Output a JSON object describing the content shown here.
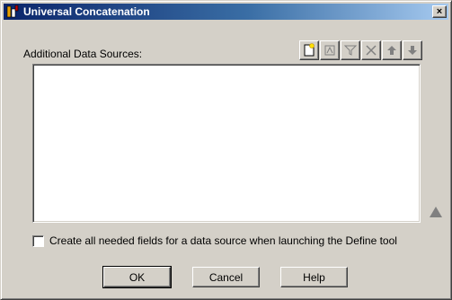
{
  "window": {
    "title": "Universal Concatenation",
    "close_glyph": "×"
  },
  "sources": {
    "label": "Additional Data Sources:",
    "items": []
  },
  "toolbar": {
    "buttons": [
      {
        "name": "new-source-icon"
      },
      {
        "name": "define-icon"
      },
      {
        "name": "filter-icon"
      },
      {
        "name": "delete-icon"
      },
      {
        "name": "move-up-icon"
      },
      {
        "name": "move-down-icon"
      }
    ]
  },
  "options": {
    "create_fields_label": "Create all needed fields for a data source when launching the Define tool",
    "create_fields_checked": false
  },
  "buttons": {
    "ok": "OK",
    "cancel": "Cancel",
    "help": "Help"
  },
  "colors": {
    "title_gradient_start": "#0a246a",
    "title_gradient_end": "#a6caf0",
    "face": "#d4d0c8"
  }
}
